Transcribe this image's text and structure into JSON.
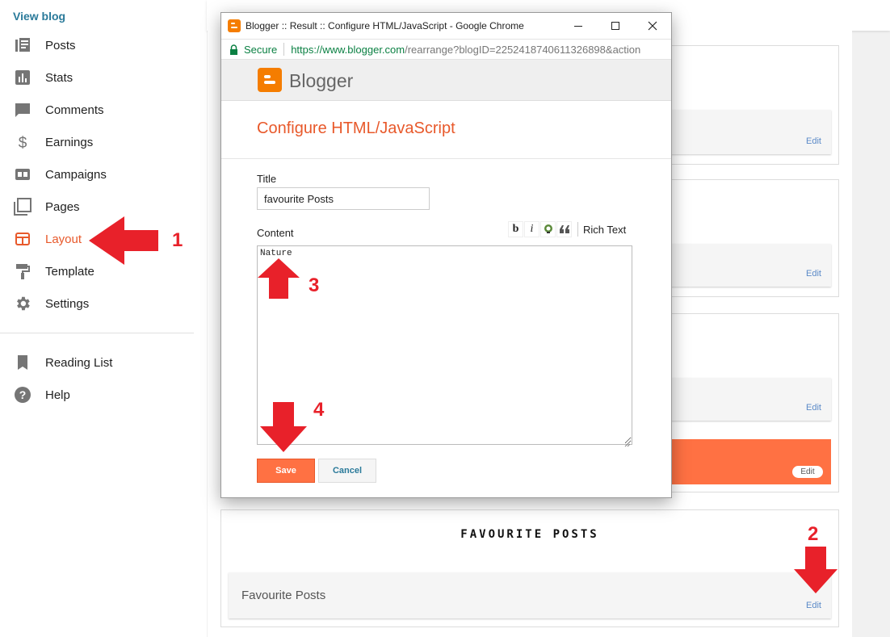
{
  "sidebar": {
    "view_blog": "View blog",
    "items": [
      {
        "label": "Posts",
        "icon": "posts-icon"
      },
      {
        "label": "Stats",
        "icon": "stats-icon"
      },
      {
        "label": "Comments",
        "icon": "comments-icon"
      },
      {
        "label": "Earnings",
        "icon": "dollar-icon"
      },
      {
        "label": "Campaigns",
        "icon": "ad-icon"
      },
      {
        "label": "Pages",
        "icon": "pages-icon"
      },
      {
        "label": "Layout",
        "icon": "layout-icon",
        "active": true
      },
      {
        "label": "Template",
        "icon": "paint-roller-icon"
      },
      {
        "label": "Settings",
        "icon": "gear-icon"
      }
    ],
    "secondary_items": [
      {
        "label": "Reading List",
        "icon": "bookmark-icon"
      },
      {
        "label": "Help",
        "icon": "help-icon"
      }
    ]
  },
  "layout": {
    "gadget_edit_label": "Edit",
    "favourite_section": {
      "title": "FAVOURITE POSTS",
      "gadget_label": "Favourite Posts",
      "edit_label": "Edit"
    }
  },
  "popup": {
    "window_title": "Blogger :: Result :: Configure HTML/JavaScript - Google Chrome",
    "secure_label": "Secure",
    "url_host": "https://www.blogger.com",
    "url_path": "/rearrange?blogID=2252418740611326898&action",
    "brand": "Blogger",
    "heading": "Configure HTML/JavaScript",
    "title_label": "Title",
    "title_value": "favourite Posts",
    "content_label": "Content",
    "content_value": "Nature",
    "toolbar": {
      "bold": "b",
      "italic": "i",
      "rich_text_label": "Rich Text"
    },
    "save_label": "Save",
    "cancel_label": "Cancel"
  },
  "annotations": [
    "1",
    "2",
    "3",
    "4"
  ],
  "colors": {
    "accent_orange": "#ff7143",
    "heading_orange": "#e8592b",
    "annotation_red": "#e8212a",
    "link_teal": "#2a7a9a",
    "secure_green": "#0b8043"
  }
}
